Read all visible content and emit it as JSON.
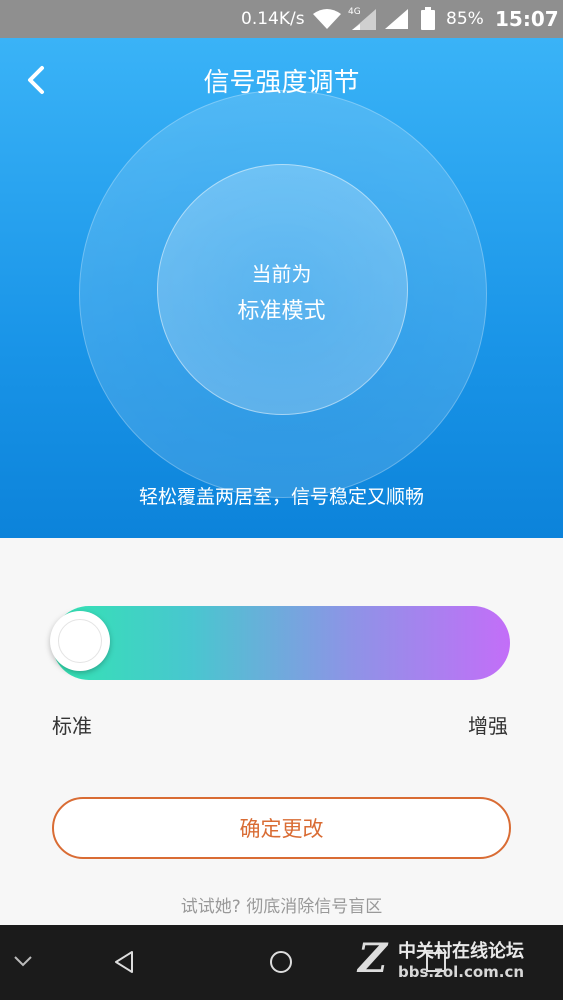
{
  "status_bar": {
    "net_speed": "0.14K/s",
    "network_type": "4G",
    "battery_pct": "85%",
    "battery_level": 0.85,
    "time": "15:07",
    "icons": [
      "wifi-icon",
      "signal-4g-icon",
      "signal-icon",
      "battery-icon"
    ]
  },
  "header": {
    "title": "信号强度调节",
    "back_icon": "chevron-left-icon"
  },
  "mode": {
    "line1": "当前为",
    "line2": "标准模式"
  },
  "description": "轻松覆盖两居室，信号稳定又顺畅",
  "slider": {
    "value": 0,
    "left_label": "标准",
    "right_label": "增强",
    "gradient": [
      "#33e4b2",
      "#c36ef8"
    ]
  },
  "confirm_button": "确定更改",
  "hint": "试试她? 彻底消除信号盲区",
  "colors": {
    "accent": "#d96c34",
    "hero_top": "#3ab3f7",
    "hero_bottom": "#0c83da"
  },
  "watermark": {
    "logo": "Z",
    "title": "中关村在线论坛",
    "url": "bbs.zol.com.cn"
  }
}
